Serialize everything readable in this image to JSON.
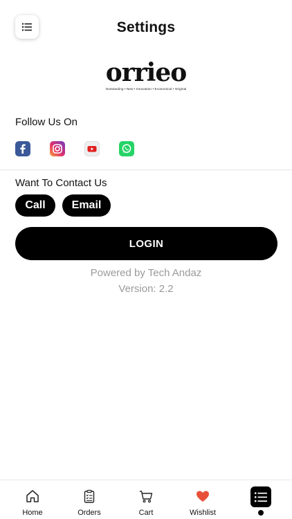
{
  "header": {
    "title": "Settings"
  },
  "logo": {
    "wordmark": "orrieo",
    "tagline": "Outstanding • New • Innovation • Economical • Original"
  },
  "follow": {
    "label": "Follow Us On",
    "networks": [
      "facebook-icon",
      "instagram-icon",
      "youtube-icon",
      "whatsapp-icon"
    ]
  },
  "contact": {
    "label": "Want To Contact Us",
    "call": "Call",
    "email": "Email"
  },
  "login": {
    "label": "LOGIN"
  },
  "footer": {
    "powered": "Powered by Tech Andaz",
    "version": "Version: 2.2"
  },
  "tabbar": {
    "items": [
      {
        "label": "Home",
        "icon": "home-icon"
      },
      {
        "label": "Orders",
        "icon": "clipboard-icon"
      },
      {
        "label": "Cart",
        "icon": "cart-icon"
      },
      {
        "label": "Wishlist",
        "icon": "heart-icon"
      },
      {
        "label": "",
        "icon": "menu-list-icon",
        "active": true
      }
    ]
  },
  "colors": {
    "accent": "#000000",
    "muted_text": "#9a9a9a",
    "heart": "#e8503a",
    "facebook": "#3b5998",
    "whatsapp": "#25d366",
    "youtube": "#e02020"
  }
}
